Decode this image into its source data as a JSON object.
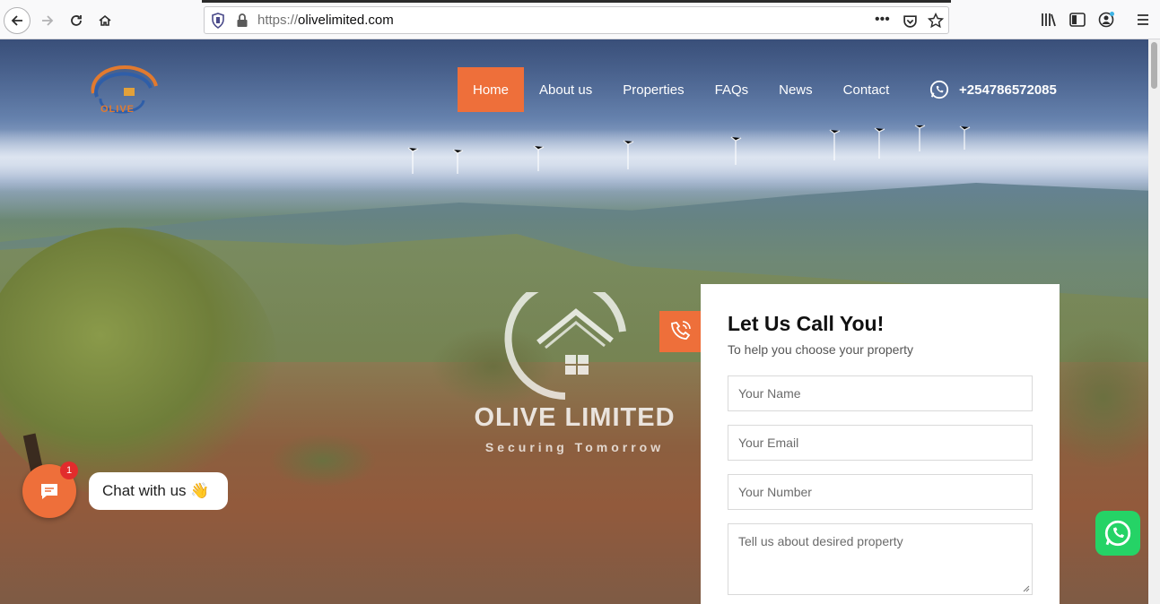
{
  "browser": {
    "url_scheme": "https://",
    "url_host": "olivelimited.com",
    "more_label": "•••"
  },
  "nav": {
    "logo_text": "OLIVE",
    "items": [
      {
        "label": "Home",
        "active": true
      },
      {
        "label": "About us"
      },
      {
        "label": "Properties"
      },
      {
        "label": "FAQs"
      },
      {
        "label": "News"
      },
      {
        "label": "Contact"
      }
    ],
    "phone": "+254786572085"
  },
  "hero": {
    "brand_title": "OLIVE LIMITED",
    "brand_subtitle": "Securing Tomorrow"
  },
  "form": {
    "title": "Let Us Call You!",
    "subtitle": "To help you choose your property",
    "name_placeholder": "Your Name",
    "email_placeholder": "Your Email",
    "number_placeholder": "Your Number",
    "message_placeholder": "Tell us about desired property"
  },
  "chat": {
    "badge": "1",
    "label": "Chat with us 👋"
  },
  "colors": {
    "accent": "#ee6f3a",
    "whatsapp": "#25d366"
  }
}
